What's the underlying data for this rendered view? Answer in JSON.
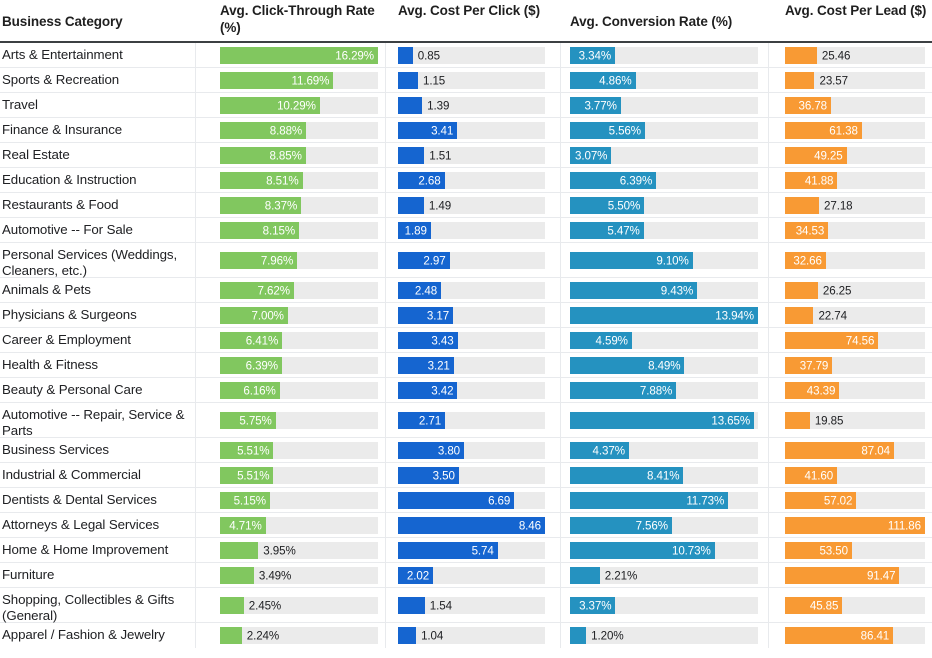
{
  "header": {
    "category": "Business Category",
    "ctr": "Avg. Click-Through Rate (%)",
    "cpc": "Avg. Cost Per Click ($)",
    "cvr": "Avg. Conversion Rate (%)",
    "cpl": "Avg. Cost Per Lead ($)"
  },
  "colors": {
    "ctr": "#81c75f",
    "cpc": "#1565d0",
    "cvr": "#2592c0",
    "cpl": "#f89a34",
    "track": "#ebebeb",
    "rule": "#3c4043",
    "grid": "#e8eaed"
  },
  "chart_data": {
    "type": "table",
    "title": "",
    "columns": [
      "Business Category",
      "Avg. Click-Through Rate (%)",
      "Avg. Cost Per Click ($)",
      "Avg. Conversion Rate (%)",
      "Avg. Cost Per Lead ($)"
    ],
    "series": [
      {
        "name": "Avg. Click-Through Rate (%)",
        "color": "#81c75f",
        "max": 16.29,
        "values": [
          16.29,
          11.69,
          10.29,
          8.88,
          8.85,
          8.51,
          8.37,
          8.15,
          7.96,
          7.62,
          7.0,
          6.41,
          6.39,
          6.16,
          5.75,
          5.51,
          5.51,
          5.15,
          4.71,
          3.95,
          3.49,
          2.45,
          2.24
        ]
      },
      {
        "name": "Avg. Cost Per Click ($)",
        "color": "#1565d0",
        "max": 8.46,
        "values": [
          0.85,
          1.15,
          1.39,
          3.41,
          1.51,
          2.68,
          1.49,
          1.89,
          2.97,
          2.48,
          3.17,
          3.43,
          3.21,
          3.42,
          2.71,
          3.8,
          3.5,
          6.69,
          8.46,
          5.74,
          2.02,
          1.54,
          1.04
        ]
      },
      {
        "name": "Avg. Conversion Rate (%)",
        "color": "#2592c0",
        "max": 13.94,
        "values": [
          3.34,
          4.86,
          3.77,
          5.56,
          3.07,
          6.39,
          5.5,
          5.47,
          9.1,
          9.43,
          13.94,
          4.59,
          8.49,
          7.88,
          13.65,
          4.37,
          8.41,
          11.73,
          7.56,
          10.73,
          2.21,
          3.37,
          1.2
        ]
      },
      {
        "name": "Avg. Cost Per Lead ($)",
        "color": "#f89a34",
        "max": 111.86,
        "values": [
          25.46,
          23.57,
          36.78,
          61.38,
          49.25,
          41.88,
          27.18,
          34.53,
          32.66,
          26.25,
          22.74,
          74.56,
          37.79,
          43.39,
          19.85,
          87.04,
          41.6,
          57.02,
          111.86,
          53.5,
          91.47,
          45.85,
          86.41
        ]
      }
    ],
    "categories": [
      "Arts & Entertainment",
      "Sports & Recreation",
      "Travel",
      "Finance & Insurance",
      "Real Estate",
      "Education & Instruction",
      "Restaurants & Food",
      "Automotive -- For Sale",
      "Personal Services (Weddings, Cleaners, etc.)",
      "Animals & Pets",
      "Physicians & Surgeons",
      "Career & Employment",
      "Health & Fitness",
      "Beauty & Personal Care",
      "Automotive -- Repair, Service & Parts",
      "Business Services",
      "Industrial & Commercial",
      "Dentists & Dental Services",
      "Attorneys & Legal Services",
      "Home & Home Improvement",
      "Furniture",
      "Shopping, Collectibles & Gifts (General)",
      "Apparel / Fashion & Jewelry"
    ]
  },
  "rows": [
    {
      "category": "Arts & Entertainment",
      "tall": false,
      "ctr": 16.29,
      "ctr_label": "16.29%",
      "ctr_inside": true,
      "cpc": 0.85,
      "cpc_label": "0.85",
      "cpc_inside": false,
      "cvr": 3.34,
      "cvr_label": "3.34%",
      "cvr_inside": true,
      "cpl": 25.46,
      "cpl_label": "25.46",
      "cpl_inside": false
    },
    {
      "category": "Sports & Recreation",
      "tall": false,
      "ctr": 11.69,
      "ctr_label": "11.69%",
      "ctr_inside": true,
      "cpc": 1.15,
      "cpc_label": "1.15",
      "cpc_inside": false,
      "cvr": 4.86,
      "cvr_label": "4.86%",
      "cvr_inside": true,
      "cpl": 23.57,
      "cpl_label": "23.57",
      "cpl_inside": false
    },
    {
      "category": "Travel",
      "tall": false,
      "ctr": 10.29,
      "ctr_label": "10.29%",
      "ctr_inside": true,
      "cpc": 1.39,
      "cpc_label": "1.39",
      "cpc_inside": false,
      "cvr": 3.77,
      "cvr_label": "3.77%",
      "cvr_inside": true,
      "cpl": 36.78,
      "cpl_label": "36.78",
      "cpl_inside": true
    },
    {
      "category": "Finance & Insurance",
      "tall": false,
      "ctr": 8.88,
      "ctr_label": "8.88%",
      "ctr_inside": true,
      "cpc": 3.41,
      "cpc_label": "3.41",
      "cpc_inside": true,
      "cvr": 5.56,
      "cvr_label": "5.56%",
      "cvr_inside": true,
      "cpl": 61.38,
      "cpl_label": "61.38",
      "cpl_inside": true
    },
    {
      "category": "Real Estate",
      "tall": false,
      "ctr": 8.85,
      "ctr_label": "8.85%",
      "ctr_inside": true,
      "cpc": 1.51,
      "cpc_label": "1.51",
      "cpc_inside": false,
      "cvr": 3.07,
      "cvr_label": "3.07%",
      "cvr_inside": true,
      "cpl": 49.25,
      "cpl_label": "49.25",
      "cpl_inside": true
    },
    {
      "category": "Education & Instruction",
      "tall": false,
      "ctr": 8.51,
      "ctr_label": "8.51%",
      "ctr_inside": true,
      "cpc": 2.68,
      "cpc_label": "2.68",
      "cpc_inside": true,
      "cvr": 6.39,
      "cvr_label": "6.39%",
      "cvr_inside": true,
      "cpl": 41.88,
      "cpl_label": "41.88",
      "cpl_inside": true
    },
    {
      "category": "Restaurants & Food",
      "tall": false,
      "ctr": 8.37,
      "ctr_label": "8.37%",
      "ctr_inside": true,
      "cpc": 1.49,
      "cpc_label": "1.49",
      "cpc_inside": false,
      "cvr": 5.5,
      "cvr_label": "5.50%",
      "cvr_inside": true,
      "cpl": 27.18,
      "cpl_label": "27.18",
      "cpl_inside": false
    },
    {
      "category": "Automotive -- For Sale",
      "tall": false,
      "ctr": 8.15,
      "ctr_label": "8.15%",
      "ctr_inside": true,
      "cpc": 1.89,
      "cpc_label": "1.89",
      "cpc_inside": true,
      "cvr": 5.47,
      "cvr_label": "5.47%",
      "cvr_inside": true,
      "cpl": 34.53,
      "cpl_label": "34.53",
      "cpl_inside": true
    },
    {
      "category": "Personal Services (Weddings, Cleaners, etc.)",
      "tall": true,
      "ctr": 7.96,
      "ctr_label": "7.96%",
      "ctr_inside": true,
      "cpc": 2.97,
      "cpc_label": "2.97",
      "cpc_inside": true,
      "cvr": 9.1,
      "cvr_label": "9.10%",
      "cvr_inside": true,
      "cpl": 32.66,
      "cpl_label": "32.66",
      "cpl_inside": true
    },
    {
      "category": "Animals & Pets",
      "tall": false,
      "ctr": 7.62,
      "ctr_label": "7.62%",
      "ctr_inside": true,
      "cpc": 2.48,
      "cpc_label": "2.48",
      "cpc_inside": true,
      "cvr": 9.43,
      "cvr_label": "9.43%",
      "cvr_inside": true,
      "cpl": 26.25,
      "cpl_label": "26.25",
      "cpl_inside": false
    },
    {
      "category": "Physicians & Surgeons",
      "tall": false,
      "ctr": 7.0,
      "ctr_label": "7.00%",
      "ctr_inside": true,
      "cpc": 3.17,
      "cpc_label": "3.17",
      "cpc_inside": true,
      "cvr": 13.94,
      "cvr_label": "13.94%",
      "cvr_inside": true,
      "cpl": 22.74,
      "cpl_label": "22.74",
      "cpl_inside": false
    },
    {
      "category": "Career & Employment",
      "tall": false,
      "ctr": 6.41,
      "ctr_label": "6.41%",
      "ctr_inside": true,
      "cpc": 3.43,
      "cpc_label": "3.43",
      "cpc_inside": true,
      "cvr": 4.59,
      "cvr_label": "4.59%",
      "cvr_inside": true,
      "cpl": 74.56,
      "cpl_label": "74.56",
      "cpl_inside": true
    },
    {
      "category": "Health & Fitness",
      "tall": false,
      "ctr": 6.39,
      "ctr_label": "6.39%",
      "ctr_inside": true,
      "cpc": 3.21,
      "cpc_label": "3.21",
      "cpc_inside": true,
      "cvr": 8.49,
      "cvr_label": "8.49%",
      "cvr_inside": true,
      "cpl": 37.79,
      "cpl_label": "37.79",
      "cpl_inside": true
    },
    {
      "category": "Beauty & Personal Care",
      "tall": false,
      "ctr": 6.16,
      "ctr_label": "6.16%",
      "ctr_inside": true,
      "cpc": 3.42,
      "cpc_label": "3.42",
      "cpc_inside": true,
      "cvr": 7.88,
      "cvr_label": "7.88%",
      "cvr_inside": true,
      "cpl": 43.39,
      "cpl_label": "43.39",
      "cpl_inside": true
    },
    {
      "category": "Automotive -- Repair, Service & Parts",
      "tall": true,
      "ctr": 5.75,
      "ctr_label": "5.75%",
      "ctr_inside": true,
      "cpc": 2.71,
      "cpc_label": "2.71",
      "cpc_inside": true,
      "cvr": 13.65,
      "cvr_label": "13.65%",
      "cvr_inside": true,
      "cpl": 19.85,
      "cpl_label": "19.85",
      "cpl_inside": false
    },
    {
      "category": "Business Services",
      "tall": false,
      "ctr": 5.51,
      "ctr_label": "5.51%",
      "ctr_inside": true,
      "cpc": 3.8,
      "cpc_label": "3.80",
      "cpc_inside": true,
      "cvr": 4.37,
      "cvr_label": "4.37%",
      "cvr_inside": true,
      "cpl": 87.04,
      "cpl_label": "87.04",
      "cpl_inside": true
    },
    {
      "category": "Industrial & Commercial",
      "tall": false,
      "ctr": 5.51,
      "ctr_label": "5.51%",
      "ctr_inside": true,
      "cpc": 3.5,
      "cpc_label": "3.50",
      "cpc_inside": true,
      "cvr": 8.41,
      "cvr_label": "8.41%",
      "cvr_inside": true,
      "cpl": 41.6,
      "cpl_label": "41.60",
      "cpl_inside": true
    },
    {
      "category": "Dentists & Dental Services",
      "tall": false,
      "ctr": 5.15,
      "ctr_label": "5.15%",
      "ctr_inside": true,
      "cpc": 6.69,
      "cpc_label": "6.69",
      "cpc_inside": true,
      "cvr": 11.73,
      "cvr_label": "11.73%",
      "cvr_inside": true,
      "cpl": 57.02,
      "cpl_label": "57.02",
      "cpl_inside": true
    },
    {
      "category": "Attorneys & Legal Services",
      "tall": false,
      "ctr": 4.71,
      "ctr_label": "4.71%",
      "ctr_inside": true,
      "cpc": 8.46,
      "cpc_label": "8.46",
      "cpc_inside": true,
      "cvr": 7.56,
      "cvr_label": "7.56%",
      "cvr_inside": true,
      "cpl": 111.86,
      "cpl_label": "111.86",
      "cpl_inside": true
    },
    {
      "category": "Home & Home Improvement",
      "tall": false,
      "ctr": 3.95,
      "ctr_label": "3.95%",
      "ctr_inside": false,
      "cpc": 5.74,
      "cpc_label": "5.74",
      "cpc_inside": true,
      "cvr": 10.73,
      "cvr_label": "10.73%",
      "cvr_inside": true,
      "cpl": 53.5,
      "cpl_label": "53.50",
      "cpl_inside": true
    },
    {
      "category": "Furniture",
      "tall": false,
      "ctr": 3.49,
      "ctr_label": "3.49%",
      "ctr_inside": false,
      "cpc": 2.02,
      "cpc_label": "2.02",
      "cpc_inside": true,
      "cvr": 2.21,
      "cvr_label": "2.21%",
      "cvr_inside": false,
      "cpl": 91.47,
      "cpl_label": "91.47",
      "cpl_inside": true
    },
    {
      "category": "Shopping, Collectibles & Gifts (General)",
      "tall": true,
      "ctr": 2.45,
      "ctr_label": "2.45%",
      "ctr_inside": false,
      "cpc": 1.54,
      "cpc_label": "1.54",
      "cpc_inside": false,
      "cvr": 3.37,
      "cvr_label": "3.37%",
      "cvr_inside": true,
      "cpl": 45.85,
      "cpl_label": "45.85",
      "cpl_inside": true
    },
    {
      "category": "Apparel / Fashion & Jewelry",
      "tall": false,
      "ctr": 2.24,
      "ctr_label": "2.24%",
      "ctr_inside": false,
      "cpc": 1.04,
      "cpc_label": "1.04",
      "cpc_inside": false,
      "cvr": 1.2,
      "cvr_label": "1.20%",
      "cvr_inside": false,
      "cpl": 86.41,
      "cpl_label": "86.41",
      "cpl_inside": true
    }
  ]
}
